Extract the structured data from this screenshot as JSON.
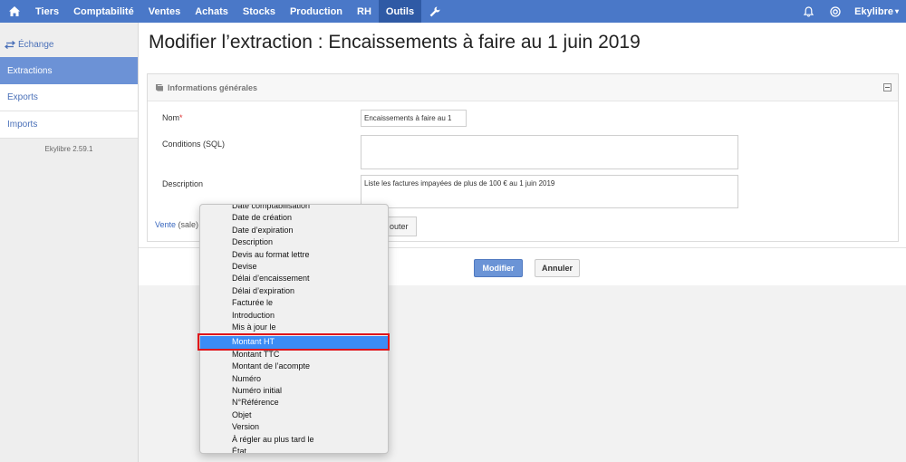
{
  "nav": {
    "items": [
      "Tiers",
      "Comptabilité",
      "Ventes",
      "Achats",
      "Stocks",
      "Production",
      "RH",
      "Outils"
    ],
    "active": "Outils",
    "user": "Ekylibre",
    "accent_color": "#4a78c8"
  },
  "sidebar": {
    "title": "Échange",
    "links": [
      "Extractions",
      "Exports",
      "Imports"
    ],
    "version": "Ekylibre 2.59.1"
  },
  "page": {
    "title": "Modifier l’extraction : Encaissements à faire au 1 juin 2019"
  },
  "panel": {
    "title": "Informations générales",
    "name_label": "Nom",
    "name_required_mark": "*",
    "name_value": "Encaissements à faire au 1",
    "conditions_label": "Conditions (SQL)",
    "conditions_value": "",
    "description_label": "Description",
    "description_value": "Liste les factures impayées de plus de 100 € au 1 juin 2019",
    "model_link": "Vente",
    "model_code": "(sale)",
    "add_button": "outer"
  },
  "actions": {
    "submit": "Modifier",
    "cancel": "Annuler"
  },
  "dropdown": {
    "items": [
      "Date comptabilisation",
      "Date de création",
      "Date d’expiration",
      "Description",
      "Devis au format lettre",
      "Devise",
      "Délai d’encaissement",
      "Délai d’expiration",
      "Facturée le",
      "Introduction",
      "Mis à jour le",
      "Montant HT",
      "Montant TTC",
      "Montant de l’acompte",
      "Numéro",
      "Numéro initial",
      "N°Référence",
      "Objet",
      "Version",
      "À régler au plus tard le",
      "État"
    ],
    "selected": "Montant HT",
    "selected_color": "#3b8cf6",
    "highlight_color": "#e0141a"
  }
}
